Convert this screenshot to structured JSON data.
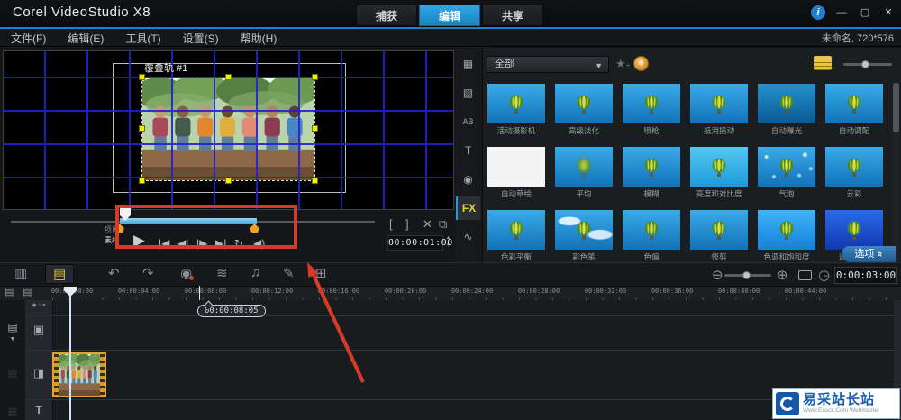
{
  "window": {
    "title": "Corel VideoStudio X8",
    "project_status": "未命名, 720*576",
    "controls": [
      {
        "name": "info",
        "glyph": "i"
      },
      {
        "name": "minimize",
        "glyph": "—"
      },
      {
        "name": "restore",
        "glyph": "▢"
      },
      {
        "name": "close",
        "glyph": "✕"
      }
    ]
  },
  "tabs": [
    {
      "label": "捕获",
      "active": false
    },
    {
      "label": "编辑",
      "active": true
    },
    {
      "label": "共享",
      "active": false
    }
  ],
  "menu": [
    "文件(F)",
    "编辑(E)",
    "工具(T)",
    "设置(S)",
    "帮助(H)"
  ],
  "preview": {
    "overlay_label": "覆叠轨 #1",
    "mode_labels": [
      "项目",
      "素材"
    ],
    "timecode": "00:00:01:00",
    "transport": [
      {
        "name": "play",
        "glyph": "▶"
      },
      {
        "name": "home",
        "glyph": "|◀"
      },
      {
        "name": "previous-frame",
        "glyph": "◀|"
      },
      {
        "name": "next-frame",
        "glyph": "|▶"
      },
      {
        "name": "end",
        "glyph": "▶|"
      },
      {
        "name": "repeat",
        "glyph": "↻"
      },
      {
        "name": "volume",
        "glyph": "◀)"
      }
    ],
    "trim_buttons": [
      {
        "name": "mark-in",
        "glyph": "["
      },
      {
        "name": "mark-out",
        "glyph": "]"
      },
      {
        "name": "split-clip",
        "glyph": "✕"
      },
      {
        "name": "enlarge",
        "glyph": "⧉"
      }
    ]
  },
  "library": {
    "filter_value": "全部",
    "options_label": "选项",
    "options_chevron": "«",
    "sidebar": [
      {
        "name": "media",
        "glyph": "▦",
        "active": false
      },
      {
        "name": "instant-project",
        "glyph": "▧",
        "active": false
      },
      {
        "name": "transition",
        "glyph": "AB",
        "active": false
      },
      {
        "name": "title",
        "glyph": "T",
        "active": false
      },
      {
        "name": "graphic",
        "glyph": "◉",
        "active": false
      },
      {
        "name": "filter",
        "glyph": "FX",
        "active": true
      },
      {
        "name": "track-motion",
        "glyph": "∿",
        "active": false
      }
    ],
    "items": [
      {
        "label": "活动摄影机",
        "variant": "normal"
      },
      {
        "label": "高级淡化",
        "variant": "normal"
      },
      {
        "label": "喷枪",
        "variant": "normal"
      },
      {
        "label": "抵消摇动",
        "variant": "normal"
      },
      {
        "label": "自动曝光",
        "variant": "dark"
      },
      {
        "label": "自动调配",
        "variant": "normal"
      },
      {
        "label": "自动草绘",
        "variant": "sketch"
      },
      {
        "label": "平均",
        "variant": "blurred"
      },
      {
        "label": "模糊",
        "variant": "normal"
      },
      {
        "label": "亮度和对比度",
        "variant": "bright"
      },
      {
        "label": "气泡",
        "variant": "bubbles"
      },
      {
        "label": "云彩",
        "variant": "normal"
      },
      {
        "label": "色彩平衡",
        "variant": "normal"
      },
      {
        "label": "彩色笔",
        "variant": "clouds"
      },
      {
        "label": "色偏",
        "variant": "normal"
      },
      {
        "label": "修剪",
        "variant": "normal"
      },
      {
        "label": "色调和饱和度",
        "variant": "vivid"
      },
      {
        "label": "迷幻光晕",
        "variant": "deepblue"
      }
    ]
  },
  "timeline": {
    "toolbar": [
      {
        "name": "storyboard-view",
        "glyph": "▥",
        "active": false
      },
      {
        "name": "timeline-view",
        "glyph": "▤",
        "active": true
      },
      {
        "name": "undo",
        "glyph": "↶",
        "active": false
      },
      {
        "name": "redo",
        "glyph": "↷",
        "active": false
      },
      {
        "name": "record-capture-options",
        "glyph": "◉",
        "active": false
      },
      {
        "name": "sound-mixer",
        "glyph": "≋",
        "active": false
      },
      {
        "name": "auto-music",
        "glyph": "♫",
        "active": false
      },
      {
        "name": "painting-creator",
        "glyph": "✎",
        "active": false
      },
      {
        "name": "subtitle-editor",
        "glyph": "⊞",
        "active": false
      }
    ],
    "zoom_controls": {
      "zoom_out": "⊖",
      "zoom_in": "⊕",
      "duration_glyph": "◷"
    },
    "duration_timecode": "0:00:03:00",
    "ruler_labels": [
      "00:00:00:00",
      "00:00:04:00",
      "00:00:08:00",
      "00:00:12:00",
      "00:00:16:00",
      "00:00:20:00",
      "00:00:24:00",
      "00:00:28:00",
      "00:00:32:00",
      "00:00:36:00",
      "00:00:40:00",
      "00:00:44:00"
    ],
    "tooltip": "00:00:08:05",
    "track_buttons": [
      "▤",
      "▤"
    ],
    "track_header_icons": [
      {
        "name": "video-track",
        "glyph": "▣"
      },
      {
        "name": "overlay-track",
        "glyph": "◨"
      },
      {
        "name": "title-track",
        "glyph": "T"
      }
    ],
    "gutter_icons": [
      {
        "name": "track-manager",
        "glyph": "▤"
      },
      {
        "name": "collapse-chevron",
        "glyph": "▼"
      }
    ]
  },
  "watermark": {
    "title": "易采站长站",
    "subtitle": "Www.Easck.Com Webmaster"
  }
}
